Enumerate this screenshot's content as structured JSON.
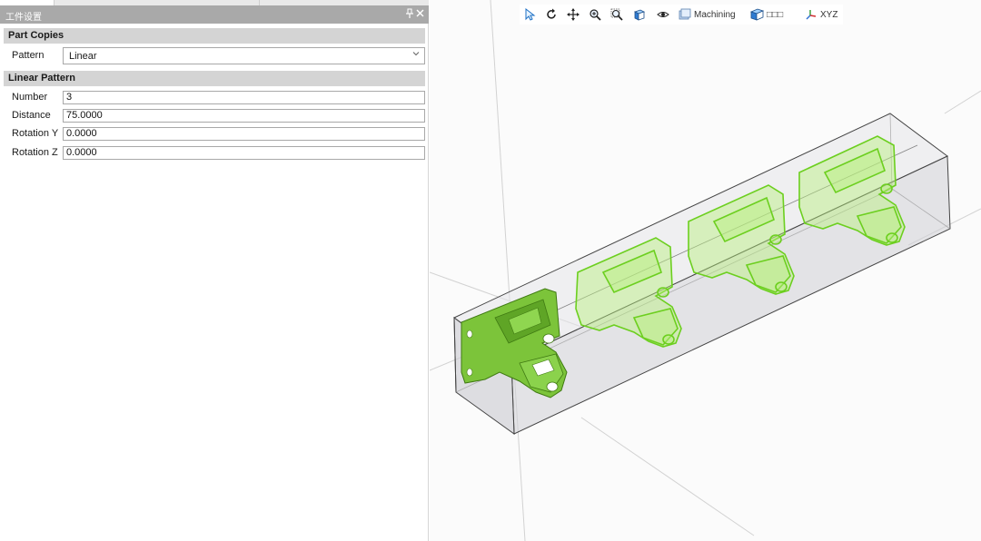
{
  "panel": {
    "title": "工件设置",
    "pin_glyph": "📌",
    "close_glyph": "✕"
  },
  "sections": {
    "part_copies": {
      "title": "Part Copies",
      "pattern_label": "Pattern",
      "pattern_value": "Linear"
    },
    "linear_pattern": {
      "title": "Linear Pattern",
      "number_label": "Number",
      "number_value": "3",
      "distance_label": "Distance",
      "distance_value": "75.0000",
      "rotation_y_label": "Rotation Y",
      "rotation_y_value": "0.0000",
      "rotation_z_label": "Rotation Z",
      "rotation_z_value": "0.0000"
    }
  },
  "toolbar": {
    "select_icon": "select-arrow-icon",
    "rotate_icon": "rotate-icon",
    "pan_icon": "pan-icon",
    "zoom_icon": "zoom-icon",
    "zoom_window_icon": "zoom-window-icon",
    "view_cube_icon": "view-cube-icon",
    "visibility_icon": "eye-icon",
    "machining_label": "Machining",
    "stock_label": "□□□",
    "axis_label": "XYZ"
  },
  "colors": {
    "part_green": "#7ed321",
    "part_outline": "#4f9d0e",
    "stock_box": "#c8c8ce",
    "panel_header": "#a9a9a9",
    "section_header": "#d4d4d4"
  }
}
